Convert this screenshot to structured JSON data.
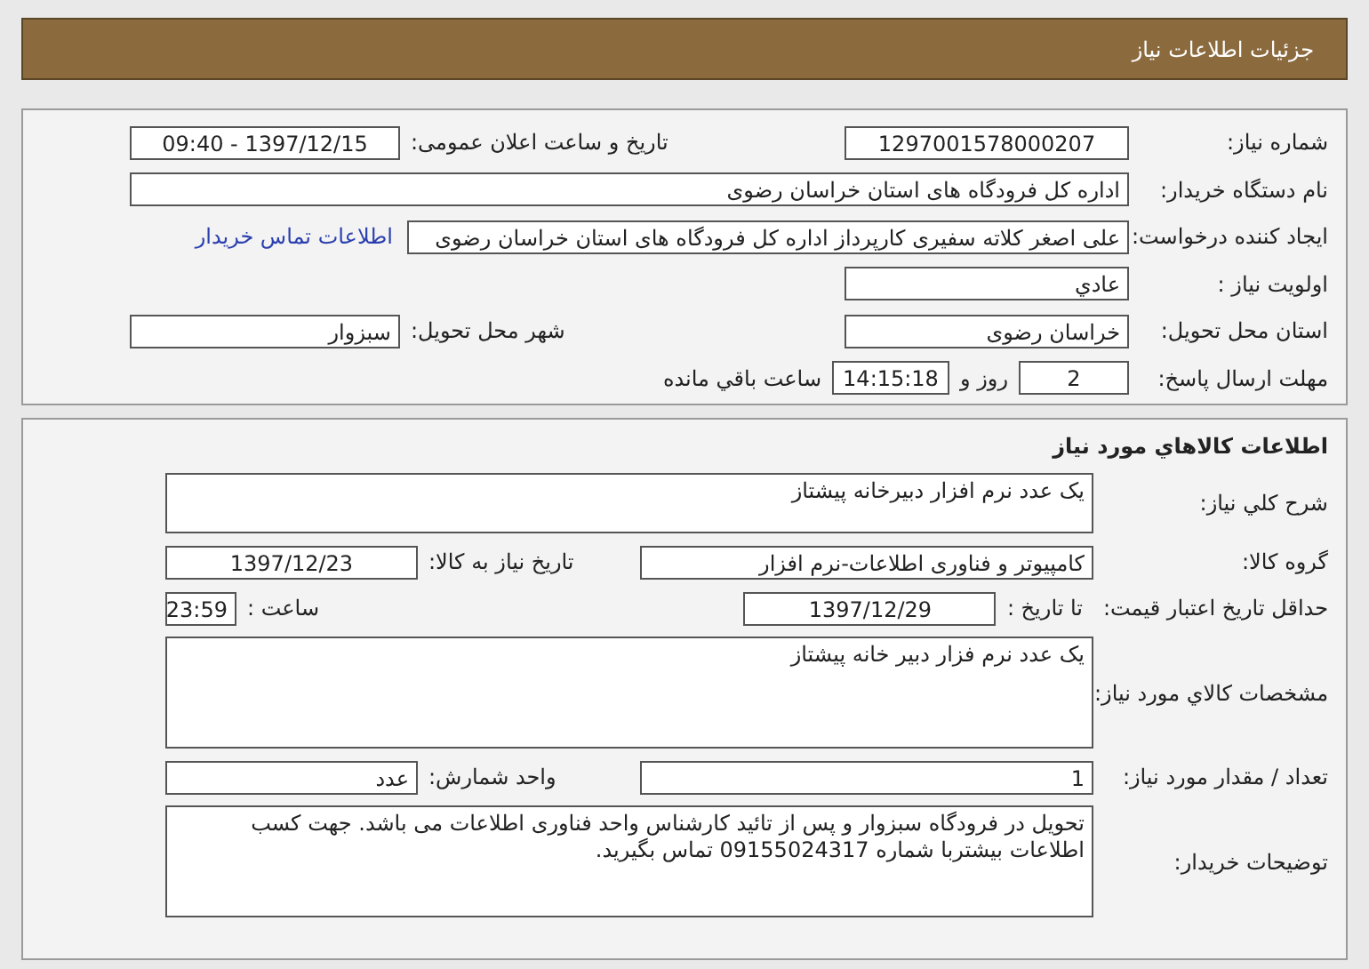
{
  "header": {
    "title": "جزئیات اطلاعات نیاز"
  },
  "panels": [
    {
      "rows": [
        {
          "items": [
            {
              "kind": "label",
              "text": "شماره نیاز:"
            },
            {
              "kind": "field",
              "text": "1297001578000207"
            },
            {
              "kind": "label2",
              "text": "تاریخ و ساعت اعلان عمومی:"
            },
            {
              "kind": "field",
              "text": "1397/12/15 - 09:40"
            }
          ]
        },
        {
          "items": [
            {
              "kind": "label",
              "text": "نام دستگاه خریدار:"
            },
            {
              "kind": "field",
              "text": "اداره کل فرودگاه های استان خراسان رضوی"
            }
          ]
        },
        {
          "items": [
            {
              "kind": "label",
              "text": "ایجاد کننده درخواست:"
            },
            {
              "kind": "field",
              "text": "علی اصغر کلاته سفیری کارپرداز اداره کل فرودگاه های استان خراسان رضوی"
            },
            {
              "kind": "link",
              "text": "اطلاعات تماس خریدار"
            }
          ]
        },
        {
          "items": [
            {
              "kind": "label",
              "text": "اولویت نیاز :"
            },
            {
              "kind": "field",
              "text": "عادي"
            }
          ]
        },
        {
          "items": [
            {
              "kind": "label",
              "text": "استان محل تحویل:"
            },
            {
              "kind": "field",
              "text": "خراسان رضوی"
            },
            {
              "kind": "label2",
              "text": "شهر محل تحویل:"
            },
            {
              "kind": "field",
              "text": "سبزوار"
            }
          ]
        },
        {
          "items": [
            {
              "kind": "label",
              "text": "مهلت ارسال پاسخ:"
            },
            {
              "kind": "field",
              "text": "2"
            },
            {
              "kind": "text",
              "text": "روز و"
            },
            {
              "kind": "field",
              "text": "14:15:18"
            },
            {
              "kind": "text",
              "text": "ساعت باقي مانده"
            }
          ]
        }
      ]
    },
    {
      "title": "اطلاعات کالاهاي مورد نياز",
      "rows": [
        {
          "items": [
            {
              "kind": "label",
              "text": "شرح کلي نياز:"
            },
            {
              "kind": "box",
              "text": "یک عدد نرم افزار دبیرخانه پیشتاز"
            }
          ]
        },
        {
          "items": [
            {
              "kind": "label",
              "text": "گروه کالا:"
            },
            {
              "kind": "field",
              "text": "کامپیوتر و فناوری اطلاعات-نرم افزار"
            },
            {
              "kind": "label2",
              "text": "تاریخ نیاز به کالا:"
            },
            {
              "kind": "field",
              "text": "1397/12/23"
            }
          ]
        },
        {
          "items": [
            {
              "kind": "label",
              "text": "حداقل تاریخ اعتبار قیمت:"
            },
            {
              "kind": "text",
              "text": "تا تاریخ :"
            },
            {
              "kind": "field",
              "text": "1397/12/29"
            },
            {
              "kind": "label2",
              "text": "ساعت :"
            },
            {
              "kind": "field",
              "text": "23:59"
            }
          ]
        },
        {
          "items": [
            {
              "kind": "label",
              "text": "مشخصات کالاي مورد نياز:"
            },
            {
              "kind": "box",
              "text": "یک عدد نرم فزار دبیر خانه پیشتاز"
            }
          ]
        },
        {
          "items": [
            {
              "kind": "label",
              "text": "تعداد / مقدار مورد نیاز:"
            },
            {
              "kind": "field",
              "text": "1"
            },
            {
              "kind": "label2",
              "text": "واحد شمارش:"
            },
            {
              "kind": "field",
              "text": "عدد"
            }
          ]
        },
        {
          "items": [
            {
              "kind": "label",
              "text": "توضیحات خریدار:"
            },
            {
              "kind": "box",
              "text": "تحویل در فرودگاه سبزوار و پس از تائید کارشناس واحد فناوری اطلاعات می باشد. جهت کسب اطلاعات بیشتربا شماره 09155024317 تماس بگیرید."
            }
          ]
        }
      ]
    }
  ]
}
